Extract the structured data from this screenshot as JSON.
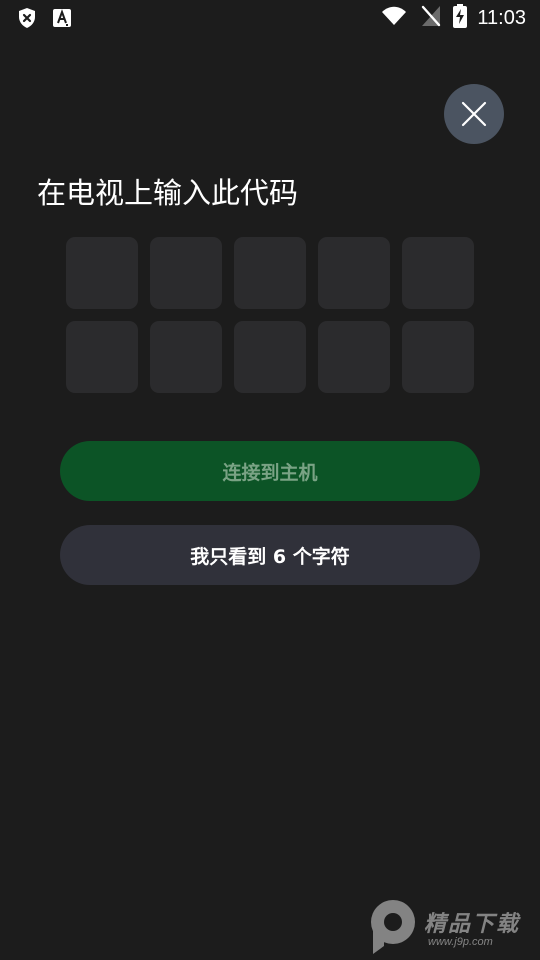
{
  "status_bar": {
    "time": "11:03",
    "icons": [
      "shield-x-icon",
      "text-a-icon",
      "wifi-icon",
      "no-sim-icon",
      "battery-charging-icon"
    ]
  },
  "close_button": {
    "icon": "close-icon"
  },
  "title": "在电视上输入此代码",
  "code_cells": [
    "",
    "",
    "",
    "",
    "",
    "",
    "",
    "",
    "",
    ""
  ],
  "buttons": {
    "connect_label": "连接到主机",
    "six_chars_label": "我只看到 6 个字符"
  },
  "colors": {
    "background": "#1c1c1c",
    "cell": "#2b2b2d",
    "connect_button": "#0c5426",
    "connect_text": "#7aa385",
    "secondary_button": "#30313a",
    "close_button": "#4b5461"
  },
  "watermark": {
    "text": "精品下载",
    "url": "www.j9p.com",
    "logo": "p-logo-icon"
  }
}
